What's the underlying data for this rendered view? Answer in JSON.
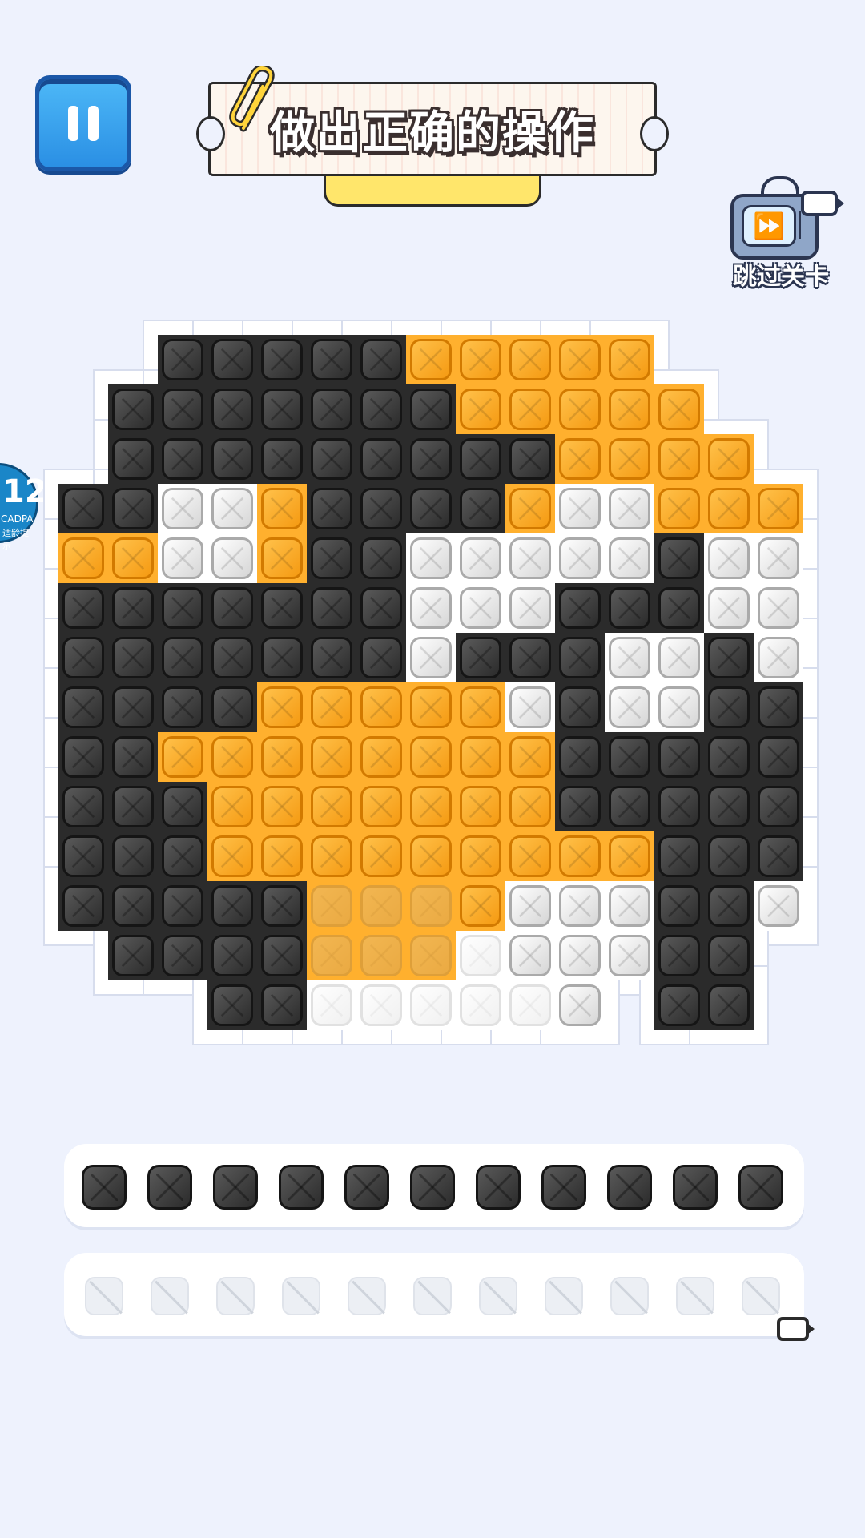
{
  "header": {
    "pause_label": "pause",
    "title": "做出正确的操作"
  },
  "skip": {
    "label": "跳过关卡",
    "icon": "tv-fast-forward-icon"
  },
  "age_badge": {
    "age": "12+",
    "org": "CADPA",
    "hint": "适龄提示"
  },
  "colors": {
    "background": "#eef2fd",
    "black": "#2b2b2b",
    "orange": "#f7a623",
    "white": "#ffffff",
    "board_fill_orange": "#ffb02e"
  },
  "board": {
    "legend": {
      "k": "black",
      "o": "orange",
      "w": "white",
      "g": "ghost-orange",
      "s": "ghost-white",
      ".": "empty"
    },
    "rows": [
      "..kkkkkooooo...",
      ".kkkkkkkooooo..",
      ".kkkkkkkkkoooo.",
      "kkwwokkkkowwooo",
      "oowwokkwwwwwkww",
      "kkkkkkkwwwkkkww",
      "kkkkkkkwkkkwwkw",
      "kkkkooooowkwwkkw",
      "kkooooooookkkkkw",
      "kkkoooooookkkkkw",
      "kkkoooooooookkkw",
      "kkkkkgggowwwkkw",
      ".kkkkgggswwwkk.",
      "...kksssssw.kk.."
    ]
  },
  "tray": {
    "beads": 11,
    "slots": 11,
    "slot_icon": "no-bead-icon",
    "ad_icon": "video-camera-icon"
  }
}
